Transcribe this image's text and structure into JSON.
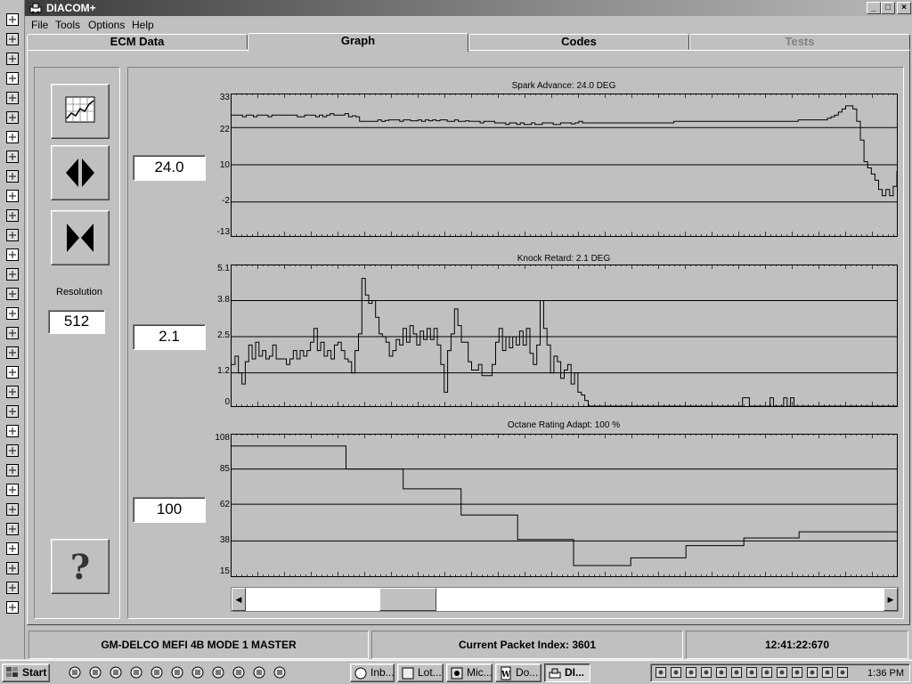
{
  "window": {
    "title": "DIACOM+",
    "controls": [
      "_",
      "□",
      "×"
    ]
  },
  "menu": [
    "File",
    "Tools",
    "Options",
    "Help"
  ],
  "tabs": [
    {
      "label": "ECM Data",
      "active": false,
      "enabled": true
    },
    {
      "label": "Graph",
      "active": true,
      "enabled": true
    },
    {
      "label": "Codes",
      "active": false,
      "enabled": true
    },
    {
      "label": "Tests",
      "active": false,
      "enabled": false
    }
  ],
  "controls": {
    "resolution_label": "Resolution",
    "resolution_value": "512",
    "buttons": [
      "graph-settings-icon",
      "expand-horizontal-icon",
      "compress-horizontal-icon",
      "help-icon"
    ]
  },
  "plots": [
    {
      "title": "Spark Advance:  24.0 DEG",
      "readout": "24.0",
      "yticks": [
        "33",
        "22",
        "10",
        "-2",
        "-13"
      ],
      "ylim": [
        -13,
        33
      ],
      "gridlines": [
        22,
        10,
        -2
      ],
      "y": [
        26,
        26,
        26,
        25.5,
        26,
        26,
        25.5,
        26,
        26,
        26,
        25.5,
        26,
        26,
        26,
        26,
        26,
        26,
        26,
        25.5,
        25.5,
        26,
        26,
        26,
        25.5,
        26,
        25.5,
        26,
        26.5,
        26,
        26,
        26,
        26.5,
        25.5,
        25.8,
        25.5,
        24,
        24,
        24,
        24,
        24,
        24.5,
        24,
        24.3,
        24.5,
        24.5,
        24.5,
        24,
        24.5,
        24.5,
        24.2,
        24.2,
        24.5,
        24,
        24.5,
        24.2,
        24.5,
        24.2,
        24.5,
        24.5,
        24,
        24,
        24.5,
        24,
        24,
        24.2,
        24,
        24,
        24,
        23.5,
        24,
        24,
        24,
        23.5,
        23.5,
        23.5,
        23,
        23.5,
        23.5,
        23,
        23.5,
        23,
        23,
        23.5,
        23,
        23,
        23.5,
        23.5,
        23.5,
        23,
        23,
        23.5,
        23.5,
        23.5,
        23.2,
        23.5,
        24,
        23.5,
        23.5,
        23.5,
        23.5,
        23.5,
        23.5,
        23.5,
        23.5,
        23.5,
        23.5,
        23.5,
        23.5,
        23.5,
        23.5,
        23.5,
        23.5,
        23.5,
        23.5,
        23.5,
        23.5,
        23.5,
        23.5,
        23.5,
        23.5,
        23.5,
        24,
        24,
        24,
        24,
        24,
        24,
        24,
        24,
        24,
        24,
        24,
        24,
        24,
        24,
        24,
        24,
        24,
        24,
        24,
        24,
        24,
        24,
        24,
        24,
        24,
        24,
        24,
        24,
        24,
        24,
        24,
        24,
        24,
        24,
        24.5,
        24.5,
        24.5,
        24.5,
        24.5,
        24.5,
        24.5,
        24.5,
        25,
        25.5,
        26,
        27,
        28,
        29,
        29,
        28,
        24,
        18,
        11,
        9,
        7,
        5,
        2,
        0,
        2,
        0,
        3,
        8
      ],
      "range": [
        -13,
        33
      ]
    },
    {
      "title": "Knock Retard:  2.1 DEG",
      "readout": "2.1",
      "yticks": [
        "5.1",
        "3.8",
        "2.5",
        "1.2",
        "0"
      ],
      "ylim": [
        0,
        5.1
      ],
      "gridlines": [
        3.8,
        2.5,
        1.2
      ],
      "y": [
        1.5,
        1.8,
        1.2,
        0.8,
        1.6,
        2.2,
        1.7,
        2.3,
        1.8,
        2.0,
        1.7,
        1.8,
        2.2,
        1.7,
        1.7,
        1.7,
        1.5,
        1.7,
        2.0,
        1.7,
        2.0,
        1.8,
        2.0,
        2.3,
        2.8,
        2.0,
        2.3,
        1.8,
        2.0,
        1.7,
        2.2,
        2.3,
        2.0,
        1.7,
        1.6,
        1.2,
        2.0,
        2.6,
        4.6,
        4.0,
        3.7,
        3.8,
        3.2,
        2.6,
        2.5,
        2.3,
        1.8,
        2.0,
        2.4,
        2.2,
        2.8,
        2.3,
        2.9,
        2.6,
        2.2,
        2.7,
        2.4,
        2.8,
        2.4,
        2.8,
        2.2,
        1.5,
        0.5,
        2.0,
        2.6,
        3.5,
        2.9,
        2.3,
        2.3,
        1.6,
        1.3,
        1.3,
        1.5,
        1.1,
        1.1,
        1.1,
        1.5,
        2.3,
        2.8,
        2.0,
        2.5,
        2.1,
        2.5,
        2.2,
        2.7,
        2.2,
        2.8,
        1.9,
        1.5,
        2.2,
        3.8,
        2.8,
        2.2,
        1.2,
        1.8,
        1.6,
        1.0,
        1.3,
        1.5,
        0.8,
        1.2,
        0.5,
        0.4,
        0.2,
        0,
        0,
        0,
        0,
        0,
        0,
        0,
        0,
        0,
        0,
        0,
        0,
        0,
        0,
        0,
        0,
        0,
        0,
        0,
        0,
        0,
        0,
        0,
        0,
        0,
        0,
        0,
        0,
        0,
        0,
        0,
        0,
        0,
        0,
        0,
        0,
        0,
        0,
        0,
        0,
        0,
        0,
        0,
        0,
        0,
        0.3,
        0.3,
        0,
        0,
        0,
        0,
        0,
        0,
        0.3,
        0,
        0,
        0,
        0.3,
        0,
        0.3,
        0,
        0,
        0,
        0,
        0,
        0,
        0,
        0,
        0,
        0,
        0,
        0,
        0,
        0,
        0,
        0,
        0,
        0,
        0,
        0,
        0,
        0,
        0,
        0,
        0,
        0,
        0,
        0,
        0,
        0,
        0
      ],
      "range": [
        0,
        5.1
      ]
    },
    {
      "title": "Octane Rating Adapt:  100 %",
      "readout": "100",
      "yticks": [
        "108",
        "85",
        "62",
        "38",
        "15"
      ],
      "ylim": [
        15,
        108
      ],
      "gridlines": [
        85,
        62,
        38
      ],
      "steps": [
        [
          0,
          100
        ],
        [
          0.172,
          100
        ],
        [
          0.172,
          85
        ],
        [
          0.258,
          85
        ],
        [
          0.258,
          72
        ],
        [
          0.345,
          72
        ],
        [
          0.345,
          55
        ],
        [
          0.43,
          55
        ],
        [
          0.43,
          39
        ],
        [
          0.514,
          39
        ],
        [
          0.514,
          22
        ],
        [
          0.6,
          22
        ],
        [
          0.6,
          27
        ],
        [
          0.683,
          27
        ],
        [
          0.683,
          35
        ],
        [
          0.77,
          35
        ],
        [
          0.77,
          40
        ],
        [
          0.853,
          40
        ],
        [
          0.853,
          44
        ],
        [
          1,
          44
        ]
      ]
    }
  ],
  "scrollbar": {
    "left_arrow": "◀",
    "right_arrow": "▶",
    "position_fraction": 0.23
  },
  "status": {
    "ecm": "GM-DELCO MEFI 4B MODE 1 MASTER",
    "packet": "Current Packet Index: 3601",
    "time": "12:41:22:670"
  },
  "taskbar": {
    "start": "Start",
    "tasks": [
      {
        "label": "Inb...",
        "pressed": false
      },
      {
        "label": "Lot...",
        "pressed": false
      },
      {
        "label": "Mic...",
        "pressed": false
      },
      {
        "label": "Do...",
        "pressed": false
      },
      {
        "label": "DI...",
        "pressed": true
      }
    ],
    "clock": "1:36 PM"
  }
}
